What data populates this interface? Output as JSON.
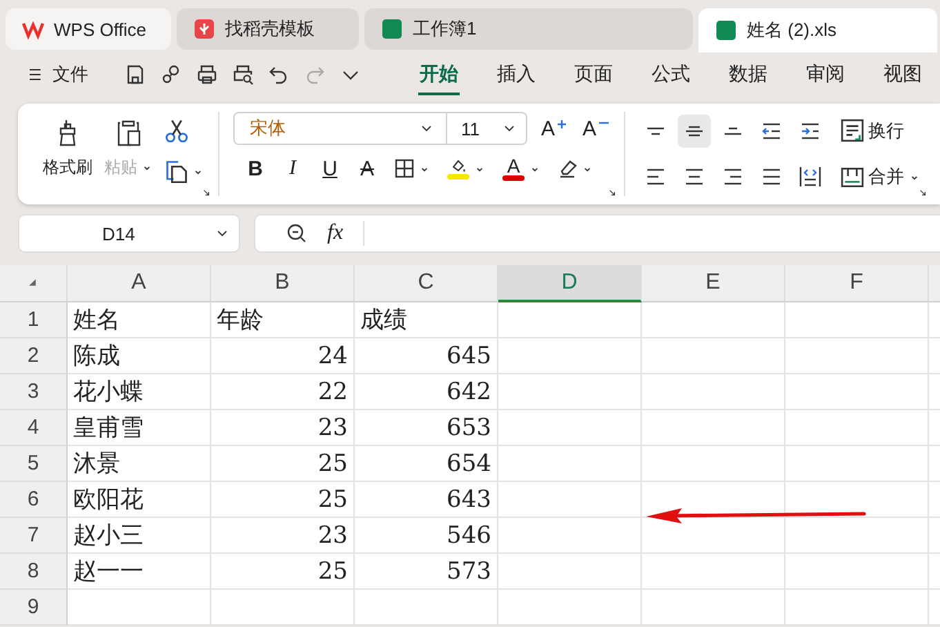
{
  "window_tabs": [
    {
      "kind": "wps",
      "label": "WPS Office",
      "selected": false
    },
    {
      "kind": "template",
      "label": "找稻壳模板",
      "selected": false
    },
    {
      "kind": "sheet",
      "label": "工作簿1",
      "selected": false
    },
    {
      "kind": "sheet",
      "label": "姓名 (2).xls",
      "selected": true
    }
  ],
  "file_menu": {
    "label": "文件"
  },
  "quick_access": [
    {
      "kind": "save",
      "disabled": false
    },
    {
      "kind": "share",
      "disabled": false
    },
    {
      "kind": "print",
      "disabled": false
    },
    {
      "kind": "preview",
      "disabled": false
    },
    {
      "kind": "undo",
      "disabled": false
    },
    {
      "kind": "redo",
      "disabled": true
    },
    {
      "kind": "more",
      "disabled": false
    }
  ],
  "ribbon_tabs": [
    {
      "label": "开始",
      "selected": true
    },
    {
      "label": "插入",
      "selected": false
    },
    {
      "label": "页面",
      "selected": false
    },
    {
      "label": "公式",
      "selected": false
    },
    {
      "label": "数据",
      "selected": false
    },
    {
      "label": "审阅",
      "selected": false
    },
    {
      "label": "视图",
      "selected": false
    }
  ],
  "clipboard": [
    {
      "kind": "format_painter",
      "label": "格式刷",
      "disabled": false
    },
    {
      "kind": "paste",
      "label": "粘贴",
      "disabled": true
    }
  ],
  "font": {
    "family": "宋体",
    "size": "11",
    "grow_glyph": "A",
    "shrink_glyph": "A",
    "buttons": [
      {
        "kind": "bold",
        "glyph": "B"
      },
      {
        "kind": "italic",
        "glyph": "I"
      },
      {
        "kind": "underline",
        "glyph": "U"
      },
      {
        "kind": "strike",
        "glyph": "A"
      }
    ],
    "font_color_glyph": "A"
  },
  "alignment": {
    "buttons": [
      {
        "kind": "top",
        "selected": false
      },
      {
        "kind": "middle",
        "selected": true
      },
      {
        "kind": "bottom",
        "selected": false
      },
      {
        "kind": "outdent",
        "selected": false
      },
      {
        "kind": "indent",
        "selected": false
      },
      {
        "kind": "left",
        "selected": false
      },
      {
        "kind": "center",
        "selected": false
      },
      {
        "kind": "right",
        "selected": false
      },
      {
        "kind": "justify",
        "selected": false
      },
      {
        "kind": "distributed",
        "selected": false
      }
    ],
    "wrap_label": "换行",
    "merge_label": "合并"
  },
  "name_box": {
    "value": "D14"
  },
  "formula_bar": {
    "fx": "fx"
  },
  "sheet": {
    "columns": [
      {
        "label": "A",
        "selected": false
      },
      {
        "label": "B",
        "selected": false
      },
      {
        "label": "C",
        "selected": false
      },
      {
        "label": "D",
        "selected": true
      },
      {
        "label": "E",
        "selected": false
      },
      {
        "label": "F",
        "selected": false
      }
    ],
    "rows": [
      {
        "number": "1",
        "cells": [
          {
            "kind": "text",
            "value": "姓名"
          },
          {
            "kind": "text",
            "value": "年龄"
          },
          {
            "kind": "text",
            "value": "成绩"
          }
        ]
      },
      {
        "number": "2",
        "cells": [
          {
            "kind": "text",
            "value": "陈成"
          },
          {
            "kind": "number",
            "value": "24"
          },
          {
            "kind": "number",
            "value": "645"
          }
        ]
      },
      {
        "number": "3",
        "cells": [
          {
            "kind": "text",
            "value": "花小蝶"
          },
          {
            "kind": "number",
            "value": "22"
          },
          {
            "kind": "number",
            "value": "642"
          }
        ]
      },
      {
        "number": "4",
        "cells": [
          {
            "kind": "text",
            "value": "皇甫雪"
          },
          {
            "kind": "number",
            "value": "23"
          },
          {
            "kind": "number",
            "value": "653"
          }
        ]
      },
      {
        "number": "5",
        "cells": [
          {
            "kind": "text",
            "value": "沐景"
          },
          {
            "kind": "number",
            "value": "25"
          },
          {
            "kind": "number",
            "value": "654"
          }
        ]
      },
      {
        "number": "6",
        "cells": [
          {
            "kind": "text",
            "value": "欧阳花"
          },
          {
            "kind": "number",
            "value": "25"
          },
          {
            "kind": "number",
            "value": "643"
          }
        ]
      },
      {
        "number": "7",
        "cells": [
          {
            "kind": "text",
            "value": "赵小三"
          },
          {
            "kind": "number",
            "value": "23"
          },
          {
            "kind": "number",
            "value": "546"
          }
        ]
      },
      {
        "number": "8",
        "cells": [
          {
            "kind": "text",
            "value": "赵一一"
          },
          {
            "kind": "number",
            "value": "25"
          },
          {
            "kind": "number",
            "value": "573"
          }
        ]
      },
      {
        "number": "9",
        "cells": []
      }
    ]
  }
}
